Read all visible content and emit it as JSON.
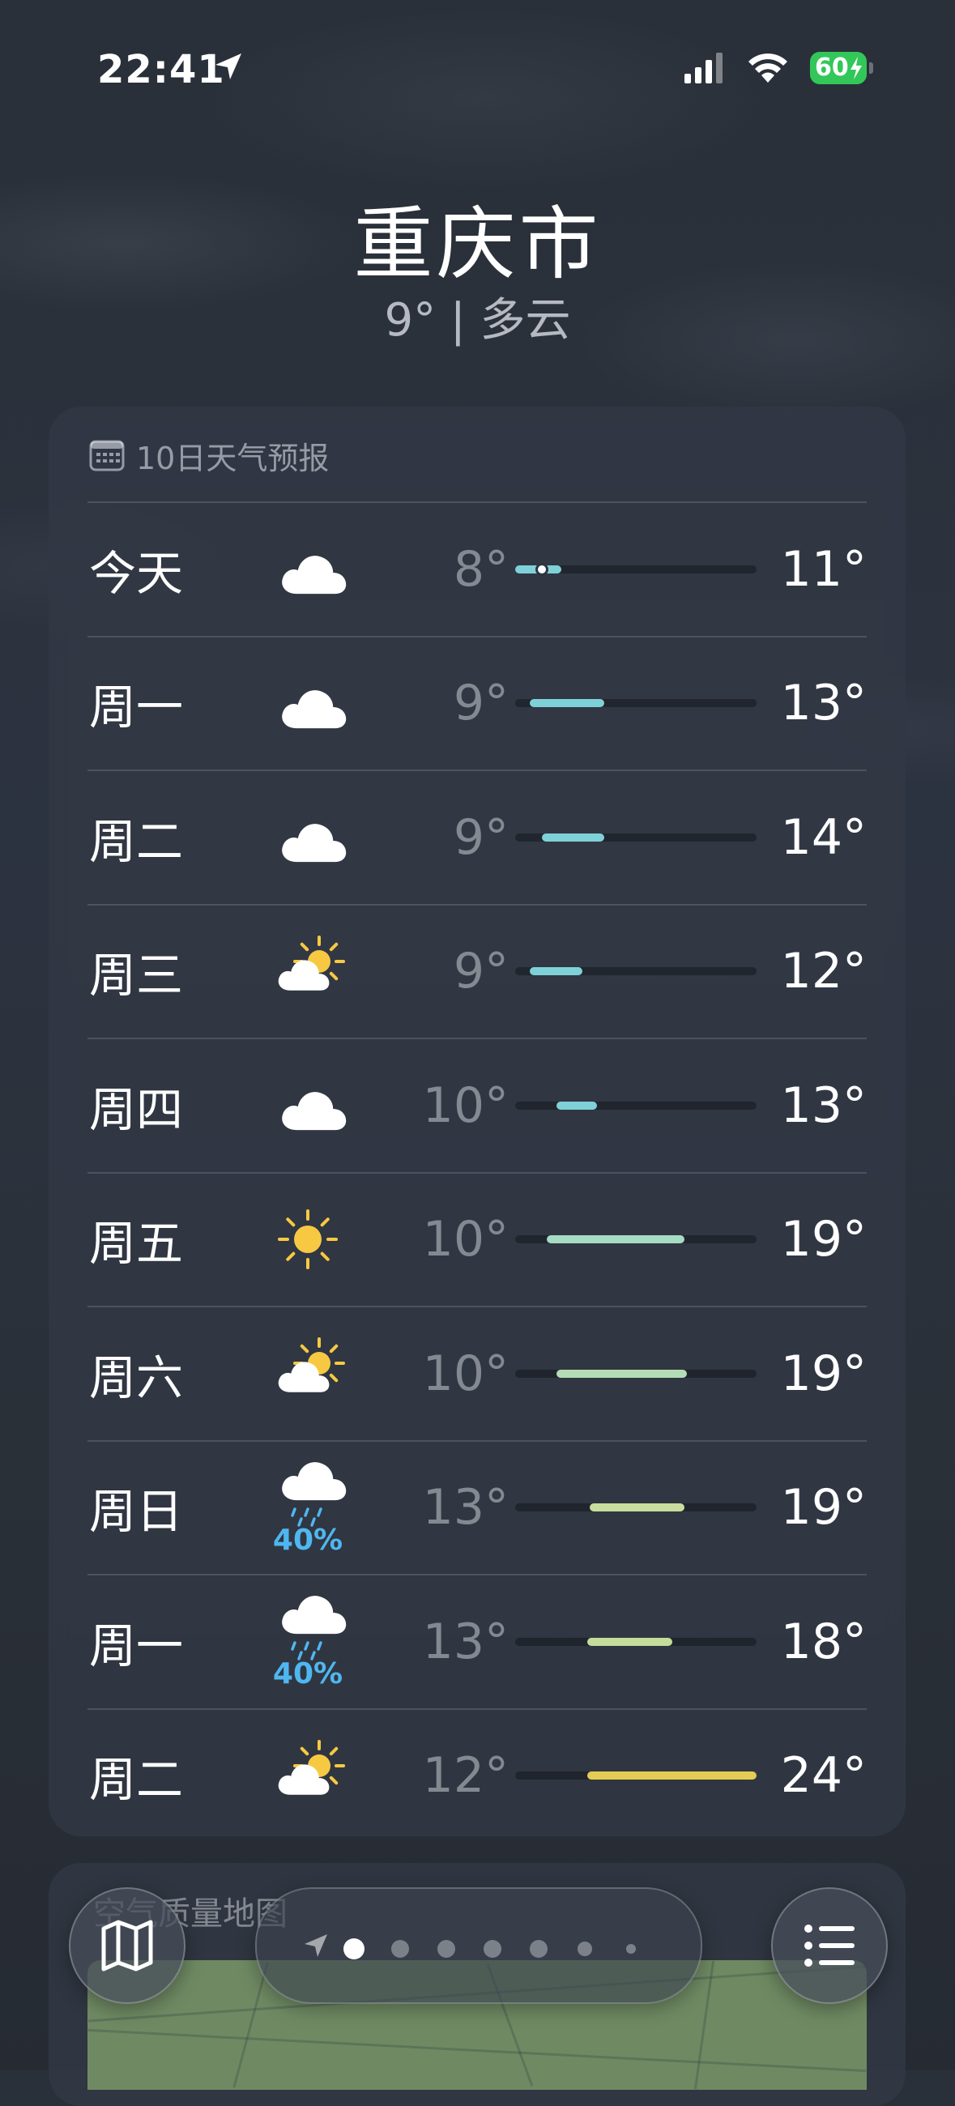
{
  "status_bar": {
    "time": "22:41",
    "battery": "60"
  },
  "location": {
    "city": "重庆市",
    "summary": "9° | 多云"
  },
  "forecast": {
    "title": "10日天气预报",
    "days": [
      {
        "day": "今天",
        "icon": "cloud-icon",
        "low": "8°",
        "high": "11°",
        "precip": "",
        "range": [
          0.0,
          0.19
        ],
        "current": 0.11,
        "color": "#7fd1d8"
      },
      {
        "day": "周一",
        "icon": "cloud-icon",
        "low": "9°",
        "high": "13°",
        "precip": "",
        "range": [
          0.06,
          0.37
        ],
        "color": "#7fd1d8"
      },
      {
        "day": "周二",
        "icon": "cloud-icon",
        "low": "9°",
        "high": "14°",
        "precip": "",
        "range": [
          0.11,
          0.37
        ],
        "color": "#7fd1d8"
      },
      {
        "day": "周三",
        "icon": "partly-sunny-icon",
        "low": "9°",
        "high": "12°",
        "precip": "",
        "range": [
          0.06,
          0.28
        ],
        "color": "#7fd1d8"
      },
      {
        "day": "周四",
        "icon": "cloud-icon",
        "low": "10°",
        "high": "13°",
        "precip": "",
        "range": [
          0.17,
          0.34
        ],
        "color": "#7fd1d8"
      },
      {
        "day": "周五",
        "icon": "sun-icon",
        "low": "10°",
        "high": "19°",
        "precip": "",
        "range": [
          0.13,
          0.7
        ],
        "color": "#a6dcc4"
      },
      {
        "day": "周六",
        "icon": "partly-sunny-icon",
        "low": "10°",
        "high": "19°",
        "precip": "",
        "range": [
          0.17,
          0.71
        ],
        "color": "#b4dcb6"
      },
      {
        "day": "周日",
        "icon": "rain-icon",
        "low": "13°",
        "high": "19°",
        "precip": "40%",
        "range": [
          0.31,
          0.7
        ],
        "color": "#c9dd9e"
      },
      {
        "day": "周一",
        "icon": "rain-icon",
        "low": "13°",
        "high": "18°",
        "precip": "40%",
        "range": [
          0.3,
          0.65
        ],
        "color": "#c5dc9b"
      },
      {
        "day": "周二",
        "icon": "partly-sunny-icon",
        "low": "12°",
        "high": "24°",
        "precip": "",
        "range": [
          0.3,
          1.0
        ],
        "color": "#e6cc55"
      }
    ]
  },
  "air_quality": {
    "title": "空气质量地图"
  },
  "pager": {
    "count": 7,
    "active": 0
  }
}
